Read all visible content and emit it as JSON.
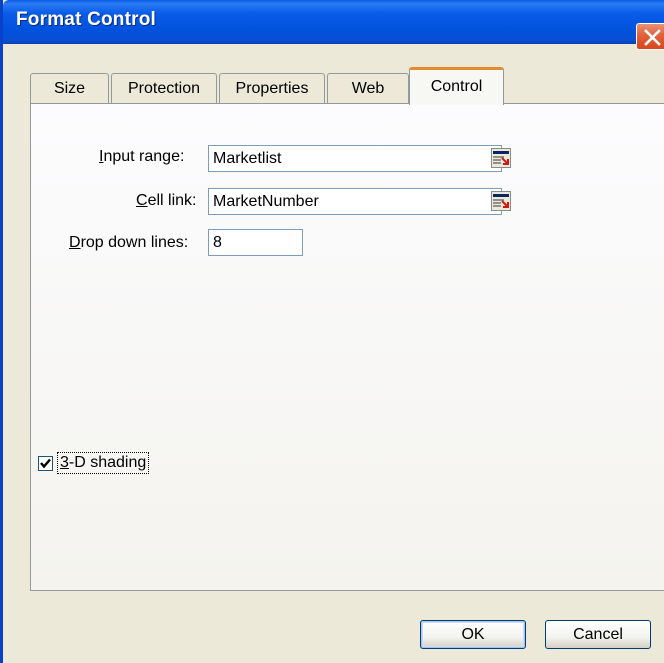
{
  "window": {
    "title": "Format Control"
  },
  "tabs": [
    {
      "label": "Size",
      "active": false
    },
    {
      "label": "Protection",
      "active": false
    },
    {
      "label": "Properties",
      "active": false
    },
    {
      "label": "Web",
      "active": false
    },
    {
      "label": "Control",
      "active": true
    }
  ],
  "control": {
    "input_range": {
      "label_accel": "I",
      "label_rest": "nput range:",
      "value": "Marketlist"
    },
    "cell_link": {
      "label_accel": "C",
      "label_rest": "ell link:",
      "value": "MarketNumber"
    },
    "drop_down_lines": {
      "label_accel": "D",
      "label_rest": "rop down lines:",
      "value": "8"
    },
    "shading": {
      "label_accel": "3",
      "label_rest": "-D shading",
      "checked": true
    }
  },
  "buttons": {
    "ok": "OK",
    "cancel": "Cancel"
  },
  "icons": {
    "close": "close-icon",
    "collapse": "collapse-dialog-icon",
    "check": "checkmark-icon"
  },
  "colors": {
    "title_bar": "#0052DD",
    "active_tab_accent": "#E68B2C",
    "close_button": "#D9461E",
    "dialog_bg": "#ECE9D8"
  }
}
